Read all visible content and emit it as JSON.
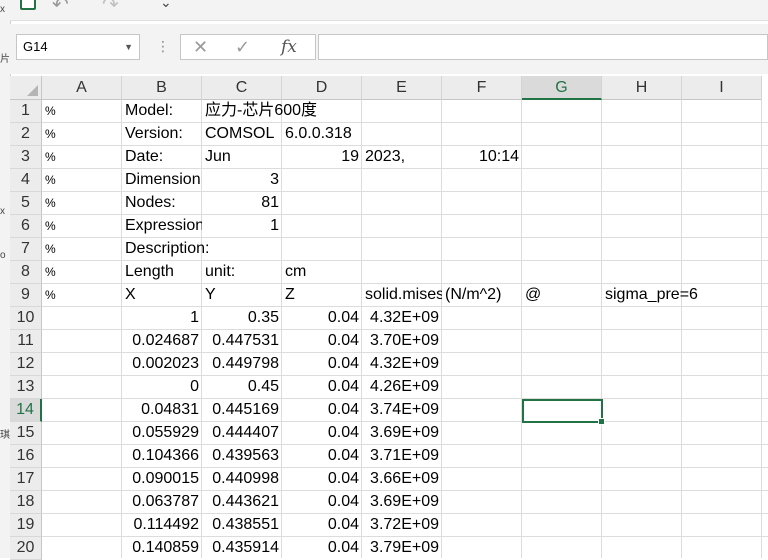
{
  "left_strip": [
    "x",
    "I",
    "片",
    "x",
    "o",
    "琪"
  ],
  "name_box": {
    "value": "G14"
  },
  "formula_bar": {
    "cancel_icon": "✕",
    "enter_icon": "✓",
    "function_icon": "fx",
    "value": ""
  },
  "columns": [
    "A",
    "B",
    "C",
    "D",
    "E",
    "F",
    "G",
    "H",
    "I"
  ],
  "selected_column": "G",
  "rows": [
    "1",
    "2",
    "3",
    "4",
    "5",
    "6",
    "7",
    "8",
    "9",
    "10",
    "11",
    "12",
    "13",
    "14",
    "15",
    "16",
    "17",
    "18",
    "19",
    "20"
  ],
  "selected_row": "14",
  "cells": {
    "r1": {
      "A": "%",
      "B": "Model:",
      "C": "应力-芯片600度"
    },
    "r2": {
      "A": "%",
      "B": "Version:",
      "C": "COMSOL",
      "D": "6.0.0.318"
    },
    "r3": {
      "A": "%",
      "B": "Date:",
      "C": "Jun",
      "D": "19",
      "E": "2023,",
      "F": "10:14"
    },
    "r4": {
      "A": "%",
      "B": "Dimension",
      "C": "3"
    },
    "r5": {
      "A": "%",
      "B": "Nodes:",
      "C": "81"
    },
    "r6": {
      "A": "%",
      "B": "Expression",
      "C": "1"
    },
    "r7": {
      "A": "%",
      "B": "Description:"
    },
    "r8": {
      "A": "%",
      "B": "Length",
      "C": "unit:",
      "D": "cm"
    },
    "r9": {
      "A": "%",
      "B": "X",
      "C": "Y",
      "D": "Z",
      "E": "solid.mises",
      "F": "(N/m^2)",
      "G": "@",
      "H": "sigma_pre=6"
    },
    "r10": {
      "B": "1",
      "C": "0.35",
      "D": "0.04",
      "E": "4.32E+09"
    },
    "r11": {
      "B": "0.024687",
      "C": "0.447531",
      "D": "0.04",
      "E": "3.70E+09"
    },
    "r12": {
      "B": "0.002023",
      "C": "0.449798",
      "D": "0.04",
      "E": "4.32E+09"
    },
    "r13": {
      "B": "0",
      "C": "0.45",
      "D": "0.04",
      "E": "4.26E+09"
    },
    "r14": {
      "B": "0.04831",
      "C": "0.445169",
      "D": "0.04",
      "E": "3.74E+09"
    },
    "r15": {
      "B": "0.055929",
      "C": "0.444407",
      "D": "0.04",
      "E": "3.69E+09"
    },
    "r16": {
      "B": "0.104366",
      "C": "0.439563",
      "D": "0.04",
      "E": "3.71E+09"
    },
    "r17": {
      "B": "0.090015",
      "C": "0.440998",
      "D": "0.04",
      "E": "3.66E+09"
    },
    "r18": {
      "B": "0.063787",
      "C": "0.443621",
      "D": "0.04",
      "E": "3.69E+09"
    },
    "r19": {
      "B": "0.114492",
      "C": "0.438551",
      "D": "0.04",
      "E": "3.72E+09"
    },
    "r20": {
      "B": "0.140859",
      "C": "0.435914",
      "D": "0.04",
      "E": "3.79E+09"
    }
  },
  "colors": {
    "accent": "#217346",
    "header_bg": "#ececec",
    "grid_line": "#dcdcdc"
  }
}
